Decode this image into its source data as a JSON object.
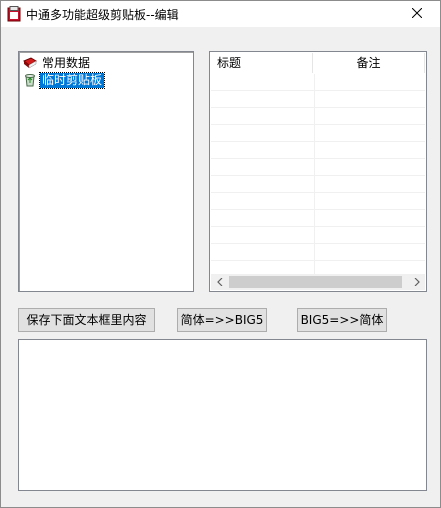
{
  "window": {
    "title": "中通多功能超级剪贴板--编辑"
  },
  "tree": {
    "items": [
      {
        "label": "常用数据",
        "icon": "red-book-icon",
        "selected": false
      },
      {
        "label": "临时剪贴板",
        "icon": "recycle-bin-icon",
        "selected": true
      }
    ]
  },
  "list": {
    "columns": [
      "标题",
      "备注"
    ],
    "rows": []
  },
  "buttons": {
    "save_label": "保存下面文本框里内容",
    "to_big5_label": "简体=>>BIG5",
    "to_simplified_label": "BIG5=>>简体"
  },
  "editor": {
    "value": ""
  },
  "colors": {
    "selection": "#0078d7",
    "button_face": "#e1e1e1",
    "window_bg": "#f0f0f0"
  }
}
